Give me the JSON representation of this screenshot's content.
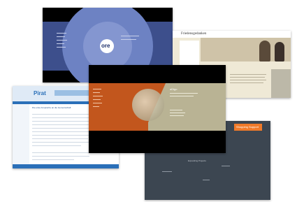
{
  "collage": {
    "cards": [
      {
        "id": "blue-circle-site",
        "logo_text": "ore",
        "menu_items": [
          "",
          "",
          "",
          "",
          "",
          "",
          ""
        ],
        "accent_color": "#5a6fb3"
      },
      {
        "id": "beige-portrait-site",
        "header_text": "Friedensgedanken",
        "accent_color": "#e9e3cf"
      },
      {
        "id": "blue-text-site",
        "header_text": "Pirat",
        "headline": "Die erste Ansprache an die Gemeinschaft",
        "accent_color": "#2a6fb8"
      },
      {
        "id": "orange-khaki-site",
        "title_text": "aDigo",
        "menu_items": [
          "",
          "",
          "",
          "",
          "",
          "",
          ""
        ],
        "accent_color": "#c2561d"
      },
      {
        "id": "slate-grey-site",
        "button_label": "Shopping Support",
        "caption": "Expanding Projects",
        "accent_color": "#f07a2a"
      }
    ]
  }
}
